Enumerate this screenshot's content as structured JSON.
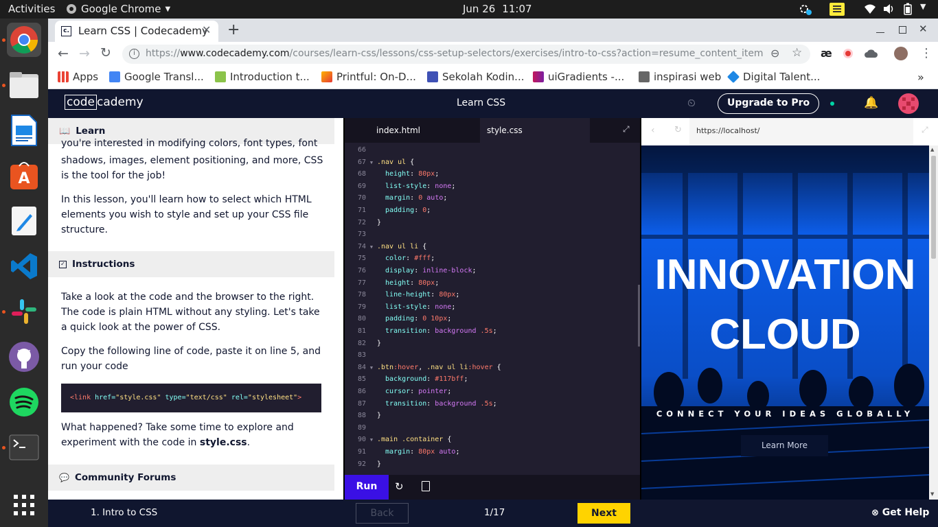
{
  "desktop": {
    "activities": "Activities",
    "app_menu": "Google Chrome",
    "date": "Jun 26",
    "time": "11:07"
  },
  "dock": {
    "items": [
      "chrome-icon",
      "files-icon",
      "writer-icon",
      "software-icon",
      "text-editor-icon",
      "vscode-icon",
      "slack-icon",
      "github-icon",
      "spotify-icon",
      "terminal-icon",
      "app-grid-icon"
    ]
  },
  "chrome": {
    "tab_title": "Learn CSS | Codecademy",
    "tab_favicon": "c.",
    "url_prefix": "https://",
    "url_host": "www.codecademy.com",
    "url_path": "/courses/learn-css/lessons/css-setup-selectors/exercises/intro-to-css?action=resume_content_item",
    "bookmarks": [
      {
        "label": "Apps",
        "color": "#4285f4"
      },
      {
        "label": "Google Transl...",
        "color": "#4285f4"
      },
      {
        "label": "Introduction t...",
        "color": "#8bc34a"
      },
      {
        "label": "Printful: On-D...",
        "color": "#e53935"
      },
      {
        "label": "Sekolah Kodin...",
        "color": "#3f51b5"
      },
      {
        "label": "uiGradients -...",
        "color": "#c2185b"
      },
      {
        "label": "inspirasi web",
        "color": "#666666"
      },
      {
        "label": "Digital Talent...",
        "color": "#1e88e5"
      }
    ],
    "ext_ae": "æ"
  },
  "codecademy": {
    "logo_code": "code",
    "logo_rest": "cademy",
    "course_title": "Learn CSS",
    "upgrade_label": "Upgrade to Pro"
  },
  "lesson": {
    "learn_label": "Learn",
    "intro_cut": "you're interested in modifying colors, font types, font sizes,",
    "intro_rest": "shadows, images, element positioning, and more, CSS is the tool for the job!",
    "lesson_para": "In this lesson, you'll learn how to select which HTML elements you wish to style and set up your CSS file structure.",
    "instructions_label": "Instructions",
    "instr_1": "Take a look at the code and the browser to the right. The code is plain HTML without any styling. Let's take a quick look at the power of CSS.",
    "instr_2": "Copy the following line of code, paste it on line 5, and run your code",
    "code_tag_open": "<link ",
    "code_attr1": "href=",
    "code_val1": "\"style.css\"",
    "code_attr2": " type=",
    "code_val2": "\"text/css\"",
    "code_attr3": " rel=",
    "code_val3": "\"stylesheet\"",
    "code_tag_close": ">",
    "after_1": "What happened? Take some time to explore and experiment with the code in ",
    "after_file": "style.css",
    "after_2": ".",
    "forums_label": "Community Forums"
  },
  "editor": {
    "tabs": [
      "index.html",
      "style.css"
    ],
    "active_tab": "style.css",
    "run_label": "Run",
    "lines": [
      {
        "n": "66",
        "fold": false,
        "segs": []
      },
      {
        "n": "67",
        "fold": true,
        "segs": [
          [
            "sel",
            ".nav ul "
          ],
          [
            "pun",
            "{"
          ]
        ]
      },
      {
        "n": "68",
        "fold": false,
        "segs": [
          [
            "prop",
            "  height"
          ],
          [
            "pun",
            ": "
          ],
          [
            "num",
            "80px"
          ],
          [
            "pun",
            ";"
          ]
        ]
      },
      {
        "n": "69",
        "fold": false,
        "segs": [
          [
            "prop",
            "  list-style"
          ],
          [
            "pun",
            ": "
          ],
          [
            "val",
            "none"
          ],
          [
            "pun",
            ";"
          ]
        ]
      },
      {
        "n": "70",
        "fold": false,
        "segs": [
          [
            "prop",
            "  margin"
          ],
          [
            "pun",
            ": "
          ],
          [
            "num",
            "0"
          ],
          [
            "pun",
            " "
          ],
          [
            "val",
            "auto"
          ],
          [
            "pun",
            ";"
          ]
        ]
      },
      {
        "n": "71",
        "fold": false,
        "segs": [
          [
            "prop",
            "  padding"
          ],
          [
            "pun",
            ": "
          ],
          [
            "num",
            "0"
          ],
          [
            "pun",
            ";"
          ]
        ]
      },
      {
        "n": "72",
        "fold": false,
        "segs": [
          [
            "pun",
            "}"
          ]
        ]
      },
      {
        "n": "73",
        "fold": false,
        "segs": []
      },
      {
        "n": "74",
        "fold": true,
        "segs": [
          [
            "sel",
            ".nav ul li "
          ],
          [
            "pun",
            "{"
          ]
        ]
      },
      {
        "n": "75",
        "fold": false,
        "segs": [
          [
            "prop",
            "  color"
          ],
          [
            "pun",
            ": "
          ],
          [
            "num",
            "#fff"
          ],
          [
            "pun",
            ";"
          ]
        ]
      },
      {
        "n": "76",
        "fold": false,
        "segs": [
          [
            "prop",
            "  display"
          ],
          [
            "pun",
            ": "
          ],
          [
            "val",
            "inline-block"
          ],
          [
            "pun",
            ";"
          ]
        ]
      },
      {
        "n": "77",
        "fold": false,
        "segs": [
          [
            "prop",
            "  height"
          ],
          [
            "pun",
            ": "
          ],
          [
            "num",
            "80px"
          ],
          [
            "pun",
            ";"
          ]
        ]
      },
      {
        "n": "78",
        "fold": false,
        "segs": [
          [
            "prop",
            "  line-height"
          ],
          [
            "pun",
            ": "
          ],
          [
            "num",
            "80px"
          ],
          [
            "pun",
            ";"
          ]
        ]
      },
      {
        "n": "79",
        "fold": false,
        "segs": [
          [
            "prop",
            "  list-style"
          ],
          [
            "pun",
            ": "
          ],
          [
            "val",
            "none"
          ],
          [
            "pun",
            ";"
          ]
        ]
      },
      {
        "n": "80",
        "fold": false,
        "segs": [
          [
            "prop",
            "  padding"
          ],
          [
            "pun",
            ": "
          ],
          [
            "num",
            "0 10px"
          ],
          [
            "pun",
            ";"
          ]
        ]
      },
      {
        "n": "81",
        "fold": false,
        "segs": [
          [
            "prop",
            "  transition"
          ],
          [
            "pun",
            ": "
          ],
          [
            "val",
            "background"
          ],
          [
            "pun",
            " "
          ],
          [
            "num",
            ".5s"
          ],
          [
            "pun",
            ";"
          ]
        ]
      },
      {
        "n": "82",
        "fold": false,
        "segs": [
          [
            "pun",
            "}"
          ]
        ]
      },
      {
        "n": "83",
        "fold": false,
        "segs": []
      },
      {
        "n": "84",
        "fold": true,
        "segs": [
          [
            "sel",
            ".btn"
          ],
          [
            "ps",
            ":hover"
          ],
          [
            "pun",
            ", "
          ],
          [
            "sel",
            ".nav ul li"
          ],
          [
            "ps",
            ":hover"
          ],
          [
            "pun",
            " {"
          ]
        ]
      },
      {
        "n": "85",
        "fold": false,
        "segs": [
          [
            "prop",
            "  background"
          ],
          [
            "pun",
            ": "
          ],
          [
            "num",
            "#117bff"
          ],
          [
            "pun",
            ";"
          ]
        ]
      },
      {
        "n": "86",
        "fold": false,
        "segs": [
          [
            "prop",
            "  cursor"
          ],
          [
            "pun",
            ": "
          ],
          [
            "val",
            "pointer"
          ],
          [
            "pun",
            ";"
          ]
        ]
      },
      {
        "n": "87",
        "fold": false,
        "segs": [
          [
            "prop",
            "  transition"
          ],
          [
            "pun",
            ": "
          ],
          [
            "val",
            "background"
          ],
          [
            "pun",
            " "
          ],
          [
            "num",
            ".5s"
          ],
          [
            "pun",
            ";"
          ]
        ]
      },
      {
        "n": "88",
        "fold": false,
        "segs": [
          [
            "pun",
            "}"
          ]
        ]
      },
      {
        "n": "89",
        "fold": false,
        "segs": []
      },
      {
        "n": "90",
        "fold": true,
        "segs": [
          [
            "sel",
            ".main .container "
          ],
          [
            "pun",
            "{"
          ]
        ]
      },
      {
        "n": "91",
        "fold": false,
        "segs": [
          [
            "prop",
            "  margin"
          ],
          [
            "pun",
            ": "
          ],
          [
            "num",
            "80px"
          ],
          [
            "pun",
            " "
          ],
          [
            "val",
            "auto"
          ],
          [
            "pun",
            ";"
          ]
        ]
      },
      {
        "n": "92",
        "fold": false,
        "segs": [
          [
            "pun",
            "}"
          ]
        ]
      }
    ]
  },
  "preview": {
    "url": "https://localhost/",
    "headline_1": "INNOVATION",
    "headline_2": "CLOUD",
    "tagline": "CONNECT YOUR IDEAS GLOBALLY",
    "button": "Learn More",
    "hero_color": "#0c5de8"
  },
  "footer": {
    "exercise": "1. Intro to CSS",
    "back": "Back",
    "progress": "1/17",
    "next": "Next",
    "help": "Get Help",
    "next_color": "#ffd300"
  }
}
